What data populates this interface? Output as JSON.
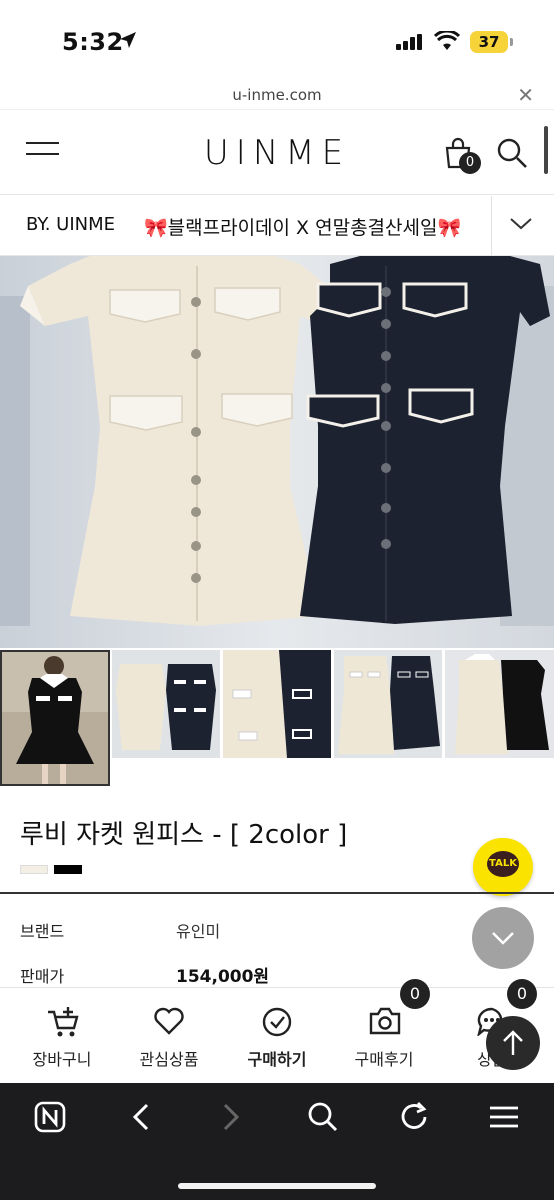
{
  "status_bar": {
    "time": "5:32",
    "battery": "37"
  },
  "browser": {
    "url": "u-inme.com"
  },
  "header": {
    "logo": "UINME",
    "cart_count": "0"
  },
  "category_bar": {
    "brand": "BY. UINME",
    "promo": "🎀블랙프라이데이 X 연말총결산세일🎀"
  },
  "product": {
    "title": "루비 자켓 원피스 - [ 2color ]",
    "swatches": [
      "#f3efe4",
      "#000000"
    ],
    "info": [
      {
        "label": "브랜드",
        "value": "유인미"
      },
      {
        "label": "판매가",
        "value": "154,000원"
      }
    ]
  },
  "talk_button": {
    "label": "TALK"
  },
  "action_bar": {
    "items": [
      {
        "label": "장바구니",
        "icon": "cart-plus-icon"
      },
      {
        "label": "관심상품",
        "icon": "heart-icon"
      },
      {
        "label": "구매하기",
        "icon": "check-circle-icon"
      },
      {
        "label": "구매후기",
        "icon": "camera-icon",
        "badge": "0"
      },
      {
        "label": "상품",
        "icon": "chat-icon",
        "badge": "0"
      }
    ]
  },
  "colors": {
    "accent_yellow": "#fbe300",
    "dark": "#222222",
    "browser_bar": "#1c1c1e"
  }
}
